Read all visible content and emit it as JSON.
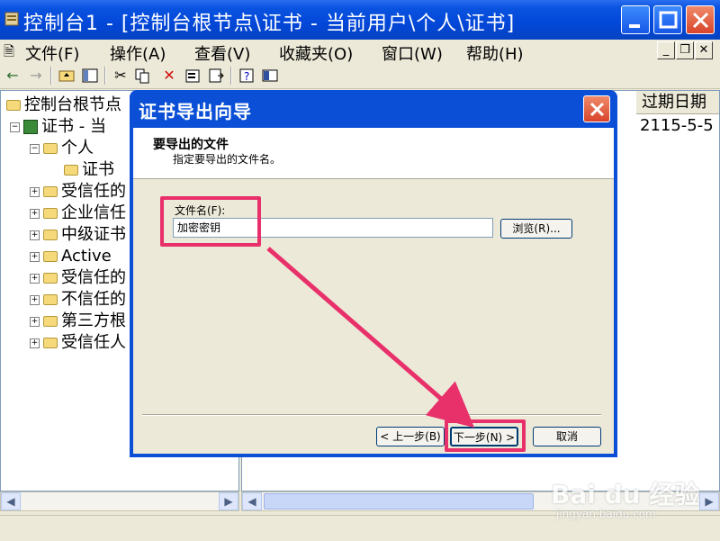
{
  "window": {
    "title": "控制台1 - [控制台根节点\\证书 - 当前用户\\个人\\证书]"
  },
  "menu": {
    "items": [
      "文件(F)",
      "操作(A)",
      "查看(V)",
      "收藏夹(O)",
      "窗口(W)",
      "帮助(H)"
    ]
  },
  "toolbar": {
    "icons": [
      "back-icon",
      "forward-icon",
      "up-folder-icon",
      "show-hide-tree-icon",
      "cut-icon",
      "copy-icon",
      "delete-icon",
      "properties-icon",
      "export-list-icon",
      "help-icon",
      "console-tree-icon"
    ]
  },
  "tree": {
    "items": [
      {
        "label": "控制台根节点",
        "indent": 0
      },
      {
        "label": "证书 - 当",
        "indent": 1
      },
      {
        "label": "个人",
        "indent": 2
      },
      {
        "label": "证书",
        "indent": 3
      },
      {
        "label": "受信任的",
        "indent": 2
      },
      {
        "label": "企业信任",
        "indent": 2
      },
      {
        "label": "中级证书",
        "indent": 2
      },
      {
        "label": "Active",
        "indent": 2
      },
      {
        "label": "受信任的",
        "indent": 2
      },
      {
        "label": "不信任的",
        "indent": 2
      },
      {
        "label": "第三方根",
        "indent": 2
      },
      {
        "label": "受信任人",
        "indent": 2
      }
    ]
  },
  "list": {
    "column_expiry": "过期日期",
    "row_expiry": "2115-5-5"
  },
  "dialog": {
    "title": "证书导出向导",
    "header_title": "要导出的文件",
    "header_subtitle": "指定要导出的文件名。",
    "filename_label": "文件名(F):",
    "filename_value": "加密密钥",
    "browse_button": "浏览(R)...",
    "back_button": "< 上一步(B)",
    "next_button": "下一步(N) >",
    "cancel_button": "取消"
  },
  "watermark": {
    "text": "Bai du 经验",
    "sub": "jingyan.baidu.com"
  },
  "colors": {
    "title_blue": "#0a53e0",
    "highlight": "#e8306a",
    "dialog_bg": "#ece9d8"
  }
}
